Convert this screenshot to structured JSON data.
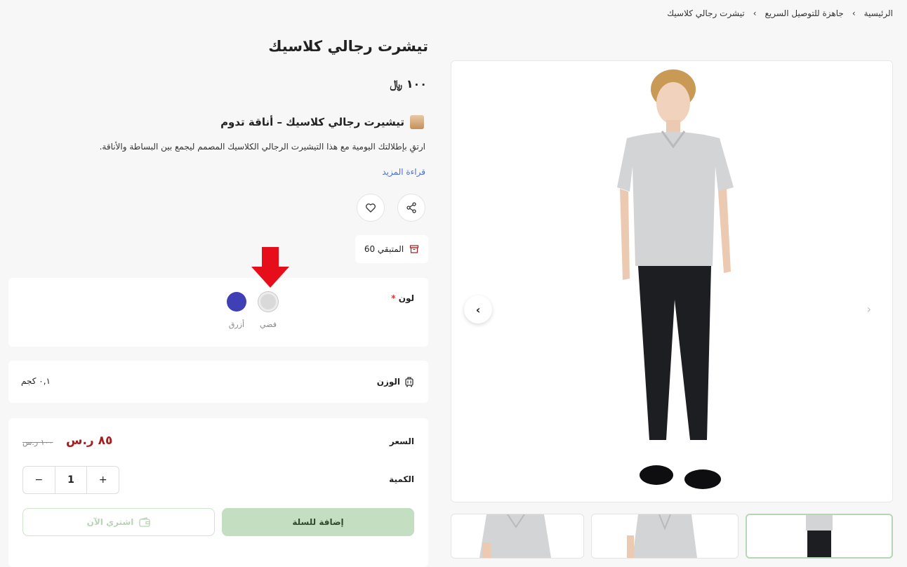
{
  "breadcrumb": {
    "home": "الرئيسية",
    "category": "جاهزة للتوصيل السريع",
    "current": "تيشرت رجالي كلاسيك",
    "sep": "›"
  },
  "product": {
    "title": "تيشرت رجالي كلاسيك",
    "price_display": "١٠٠ ﷼",
    "heading": "تيشيرت رجالي كلاسيك – أناقة تدوم",
    "description": "ارتقِ بإطلالتك اليومية مع هذا التيشيرت الرجالي الكلاسيك المصمم ليجمع بين البساطة والأناقة.",
    "read_more": "قراءة المزيد",
    "stock_label": "المتبقي 60"
  },
  "color": {
    "label": "لون",
    "required_mark": "*",
    "options": [
      {
        "name": "فضي",
        "hex": "#d6d6d6",
        "selected": true
      },
      {
        "name": "أزرق",
        "hex": "#3f3fb6",
        "selected": false
      }
    ]
  },
  "weight": {
    "label": "الوزن",
    "value": "٠,١ كجم"
  },
  "purchase": {
    "price_label": "السعر",
    "price_new": "٨٥ ر.س",
    "price_old": "١٠٠ ر.س",
    "quantity_label": "الكمية",
    "quantity": "1",
    "minus": "−",
    "plus": "+",
    "add_to_cart": "إضافة للسلة",
    "buy_now": "اشتري الآن"
  },
  "gallery": {
    "prev": "‹",
    "next": "›"
  },
  "colors": {
    "accent_green": "#c3dec1",
    "price_red": "#a51f1f",
    "link_blue": "#4a6fd1"
  }
}
